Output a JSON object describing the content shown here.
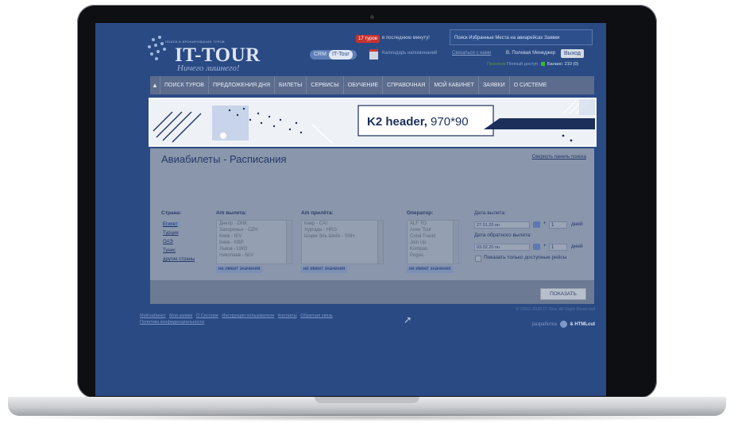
{
  "header": {
    "tagline": "поиск и бронирование туров",
    "logo": "IT-TOUR",
    "slogan": "Ничего лишнего!",
    "hot_badge": "17 туров",
    "hot_text": "в последнюю минуту!",
    "crm_label": "CRM",
    "crm_badge": "IT-Tour",
    "calendar_link": "Календарь напоминаний",
    "top_nav": "Поиск Избранные Места на авиарейсах Заявки",
    "contact_link": "Связаться с нами",
    "user": "В. Полевая Менеджер",
    "logout": "Выход",
    "status_premium": "Премиум",
    "status_full_access": "Полный доступ",
    "balance": "Баланс: 210 (0)"
  },
  "nav": {
    "items": [
      "ПОИСК ТУРОВ",
      "ПРЕДЛОЖЕНИЯ ДНЯ",
      "БИЛЕТЫ",
      "СЕРВИСЫ",
      "ОБУЧЕНИЕ",
      "СПРАВОЧНАЯ",
      "МОЙ КАБИНЕТ",
      "ЗАЯВКИ",
      "О СИСТЕМЕ"
    ]
  },
  "banner": {
    "title": "K2 header,",
    "size": " 970*90"
  },
  "search": {
    "page_title": "Авиабилеты - Расписания",
    "collapse_link": "Свернуть панель поиска",
    "country_label": "Страна:",
    "countries": [
      "Египет",
      "Турция",
      "ОАЭ",
      "Тунис",
      "другие страны"
    ],
    "departure_label": "А/п вылета:",
    "departure_items": [
      "Днепр - DNK",
      "Запорожье - OZH",
      "Киев - IEV",
      "Киев - KBP",
      "Львов - LWO",
      "Николаев - NLV"
    ],
    "arrival_label": "А/п прилёта:",
    "arrival_items": [
      "Каир - CAI",
      "Хургада - HRG",
      "Шарм Эль Шейх - SSH"
    ],
    "operator_label": "Оператор:",
    "operator_items": [
      "ALF TO",
      "Anex Tour",
      "Coral Travel",
      "Join Up",
      "Kompas",
      "Pegas"
    ],
    "no_value": "не имеет значения",
    "departure_date_label": "Дата вылета:",
    "departure_date": "27.01.20 пн",
    "return_date_label": "Дата обратного вылета:",
    "return_date": "03.02.20 пн",
    "plus": "+",
    "days_value": "1",
    "days_label": "дней",
    "only_available": "Показать только доступные рейсы",
    "show_button": "ПОКАЗАТЬ"
  },
  "footer": {
    "links": [
      "Мой кабинет",
      "Мои заявки",
      "О Системе",
      "Инструкция пользователя",
      "Контакты",
      "Обратная связь",
      "Политика конфиденциальности"
    ],
    "copyright": "© 2002–2020 IT-Tour. All Right Reserved",
    "dev_text": "разработка",
    "dev_brand": "& HTMLcut"
  },
  "colors": {
    "screen_bg": "#2a4a84",
    "nav_bg": "#5c6c8d",
    "banner_bg": "#eef1f6",
    "accent_red": "#c8322f"
  }
}
